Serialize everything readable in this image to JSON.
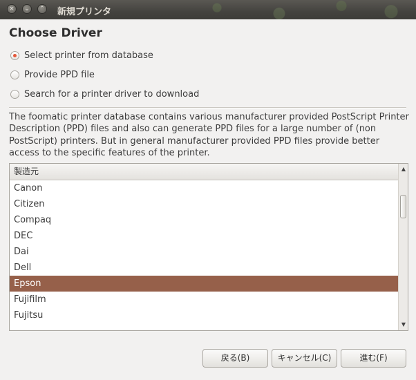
{
  "window": {
    "title": "新規プリンタ",
    "close_glyph": "×",
    "minimize_glyph": "⌄",
    "maximize_glyph": "⌃"
  },
  "heading": "Choose Driver",
  "options": [
    {
      "label": "Select printer from database",
      "checked": true
    },
    {
      "label": "Provide PPD file",
      "checked": false
    },
    {
      "label": "Search for a printer driver to download",
      "checked": false
    }
  ],
  "description": "The foomatic printer database contains various manufacturer provided PostScript Printer Description (PPD) files and also can generate PPD files for a large number of (non PostScript) printers. But in general manufacturer provided PPD files provide better access to the specific features of the printer.",
  "list": {
    "header": "製造元",
    "items": [
      "Canon",
      "Citizen",
      "Compaq",
      "DEC",
      "Dai",
      "Dell",
      "Epson",
      "Fujifilm",
      "Fujitsu"
    ],
    "selected": "Epson"
  },
  "buttons": {
    "back": "戻る(B)",
    "cancel": "キャンセル(C)",
    "forward": "進む(F)"
  },
  "colors": {
    "selection": "#96604a",
    "radio_accent": "#e4573a"
  }
}
